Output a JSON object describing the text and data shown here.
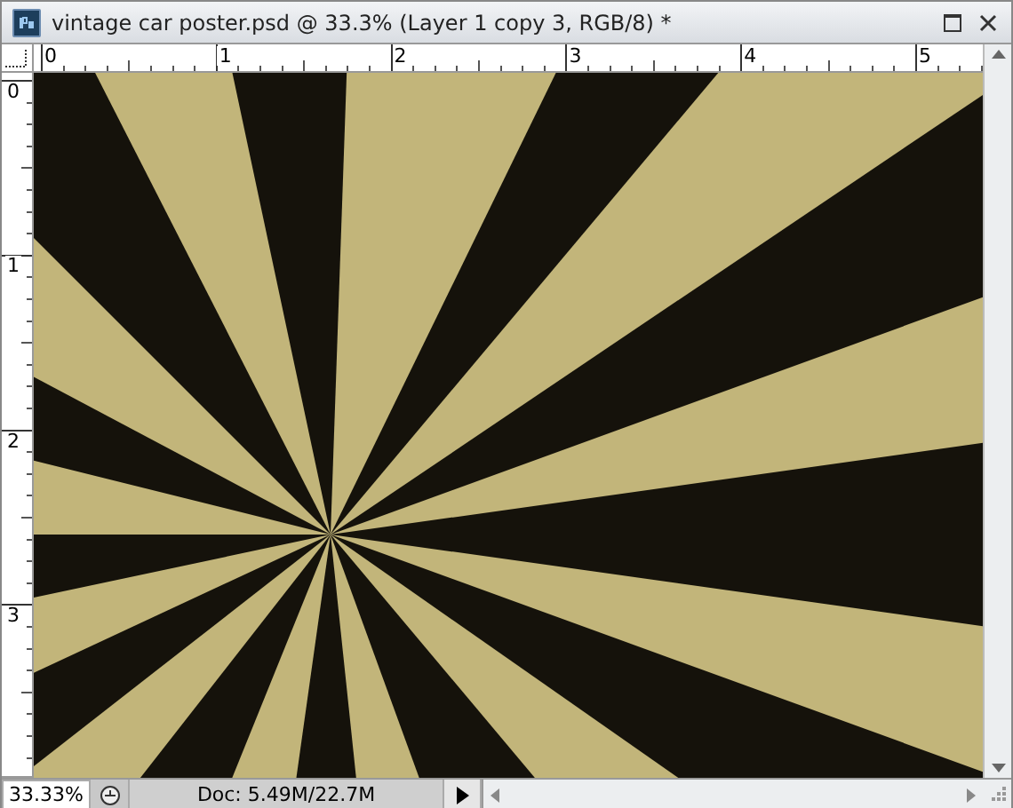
{
  "window": {
    "title": "vintage car poster.psd @ 33.3% (Layer 1 copy 3, RGB/8) *"
  },
  "rulers": {
    "horizontal": [
      "0",
      "1",
      "2",
      "3",
      "4",
      "5"
    ],
    "vertical": [
      "0",
      "1",
      "2",
      "3"
    ]
  },
  "status_bar": {
    "zoom": "33.33%",
    "doc_info": "Doc: 5.49M/22.7M"
  }
}
